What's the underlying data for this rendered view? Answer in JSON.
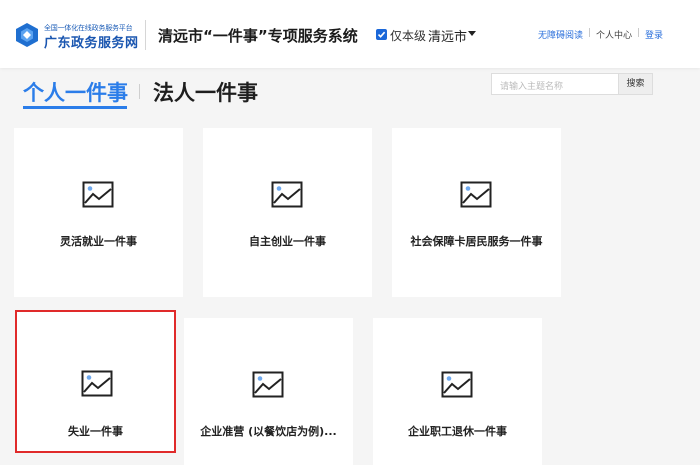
{
  "header": {
    "logo_small_text": "全国一体化在线政务服务平台",
    "logo_big_text": "广东政务服务网",
    "system_title": "清远市“一件事”专项服务系统",
    "level_checkbox_label": "仅本级",
    "city": "清远市",
    "links": {
      "accessibility": "无障碍阅读",
      "separator": "|",
      "user_center": "个人中心",
      "login": "登录"
    }
  },
  "tabs": {
    "personal": "个人一件事",
    "legal": "法人一件事"
  },
  "search": {
    "placeholder": "请输入主题名称",
    "button": "搜索"
  },
  "cards": [
    "灵活就业一件事",
    "自主创业一件事",
    "社会保障卡居民服务一件事",
    "失业一件事",
    "企业准营 (以餐饮店为例)...",
    "企业职工退休一件事"
  ],
  "colors": {
    "accent": "#2b7de9",
    "selected_border": "#e02a2a",
    "brand": "#1a56b0"
  },
  "icons": {
    "logo": "gd-logo-icon",
    "card": "image-placeholder-icon",
    "check": "checkbox-checked-icon",
    "dropdown": "caret-down-icon"
  }
}
